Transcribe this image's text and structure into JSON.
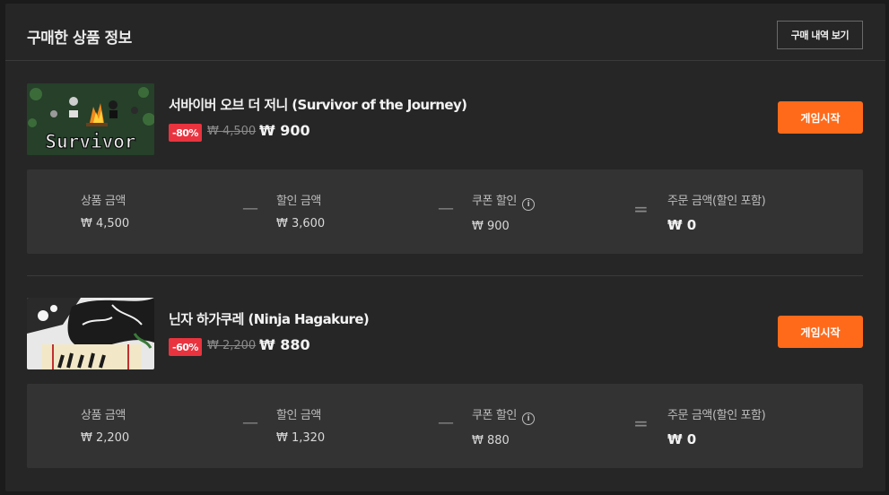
{
  "header": {
    "title": "구매한 상품 정보",
    "history_button": "구매 내역 보기"
  },
  "labels": {
    "product_amount": "상품 금액",
    "discount_amount": "할인 금액",
    "coupon_discount": "쿠폰 할인",
    "order_amount": "주문 금액(할인 포함)",
    "play_button": "게임시작"
  },
  "products": [
    {
      "thumb_text": "Survivor",
      "title": "서바이버 오브 더 저니 (Survivor of the Journey)",
      "discount": "-80%",
      "original_price": "₩ 4,500",
      "sale_price": "₩ 900",
      "summary": {
        "product_amount": "₩ 4,500",
        "discount_amount": "₩ 3,600",
        "coupon_discount": "₩ 900",
        "order_amount": "₩ 0"
      }
    },
    {
      "title": "닌자 하가쿠레 (Ninja Hagakure)",
      "discount": "-60%",
      "original_price": "₩ 2,200",
      "sale_price": "₩ 880",
      "summary": {
        "product_amount": "₩ 2,200",
        "discount_amount": "₩ 1,320",
        "coupon_discount": "₩ 880",
        "order_amount": "₩ 0"
      }
    }
  ],
  "colors": {
    "accent": "#ff6a1a",
    "discount_badge": "#e9343f",
    "panel": "#262626",
    "summary_bg": "#333333"
  }
}
